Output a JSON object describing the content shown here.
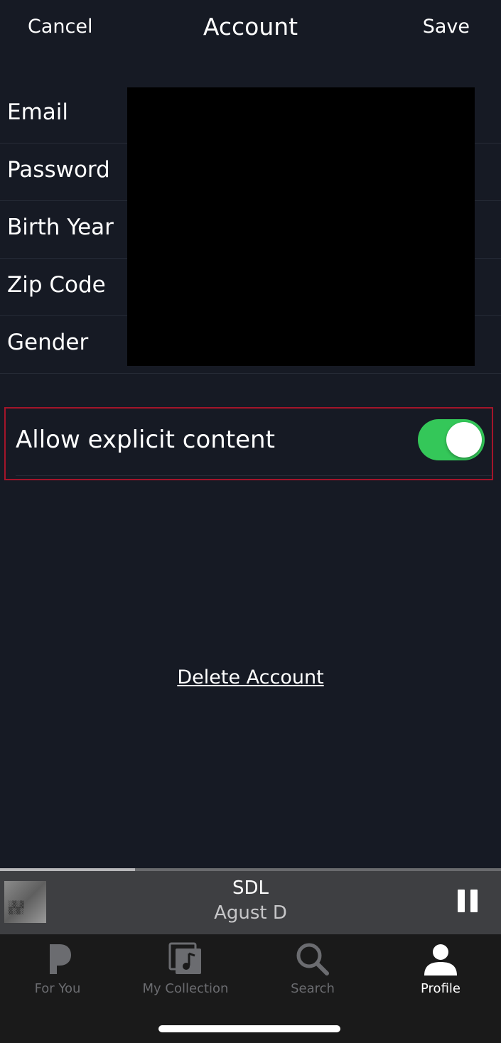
{
  "nav": {
    "cancel_label": "Cancel",
    "title": "Account",
    "save_label": "Save"
  },
  "form": {
    "rows": [
      {
        "label": "Email"
      },
      {
        "label": "Password"
      },
      {
        "label": "Birth Year"
      },
      {
        "label": "Zip Code"
      },
      {
        "label": "Gender"
      }
    ]
  },
  "explicit": {
    "label": "Allow explicit content",
    "enabled": true,
    "toggle_color": "#34c759"
  },
  "delete_label": "Delete Account",
  "player": {
    "title": "SDL",
    "artist": "Agust D",
    "progress": 0.27,
    "state": "playing"
  },
  "tabs": [
    {
      "label": "For You",
      "icon": "pandora-p-icon",
      "active": false
    },
    {
      "label": "My Collection",
      "icon": "collection-icon",
      "active": false
    },
    {
      "label": "Search",
      "icon": "search-icon",
      "active": false
    },
    {
      "label": "Profile",
      "icon": "profile-icon",
      "active": true
    }
  ],
  "colors": {
    "background": "#161a24",
    "highlight_border": "#a3152a",
    "tabbar": "#1a1a1a"
  }
}
